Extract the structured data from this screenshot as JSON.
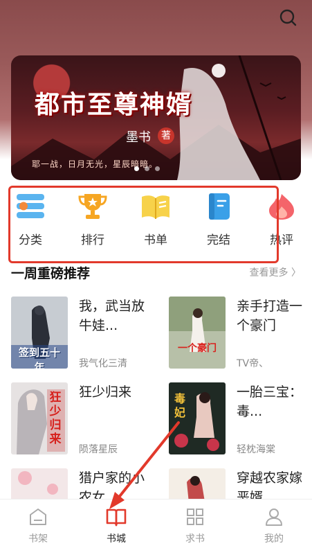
{
  "banner": {
    "title": "都市至尊神婿",
    "author": "墨书",
    "author_suffix": "著",
    "tagline": "耶一战，日月无光，星辰暗暗。"
  },
  "categories": [
    {
      "label": "分类",
      "icon": "category-list-icon"
    },
    {
      "label": "排行",
      "icon": "trophy-icon"
    },
    {
      "label": "书单",
      "icon": "open-book-icon"
    },
    {
      "label": "完结",
      "icon": "finished-book-icon"
    },
    {
      "label": "热评",
      "icon": "flame-icon"
    }
  ],
  "section": {
    "title": "一周重磅推荐",
    "more_label": "查看更多 〉"
  },
  "books": [
    {
      "title": "我，武当放牛娃...",
      "author": "我气化三清",
      "cover_text": "签到五十年"
    },
    {
      "title": "亲手打造一个豪门",
      "author": "TV帝、",
      "cover_text": "一个豪门"
    },
    {
      "title": "狂少归来",
      "author": "陨落星辰",
      "cover_text": "狂少归来"
    },
    {
      "title": "一胎三宝：毒...",
      "author": "轻枕海棠",
      "cover_text": "毒妃"
    },
    {
      "title": "猎户家的小农女",
      "author": "",
      "cover_text": ""
    },
    {
      "title": "穿越农家嫁恶婿",
      "author": "",
      "cover_text": ""
    }
  ],
  "tabs": [
    {
      "label": "书架",
      "icon": "bookshelf-icon"
    },
    {
      "label": "书城",
      "icon": "book-city-icon"
    },
    {
      "label": "求书",
      "icon": "grid-icon"
    },
    {
      "label": "我的",
      "icon": "profile-icon"
    }
  ],
  "colors": {
    "accent": "#e2392b",
    "highlight_box": "#e2392b"
  }
}
